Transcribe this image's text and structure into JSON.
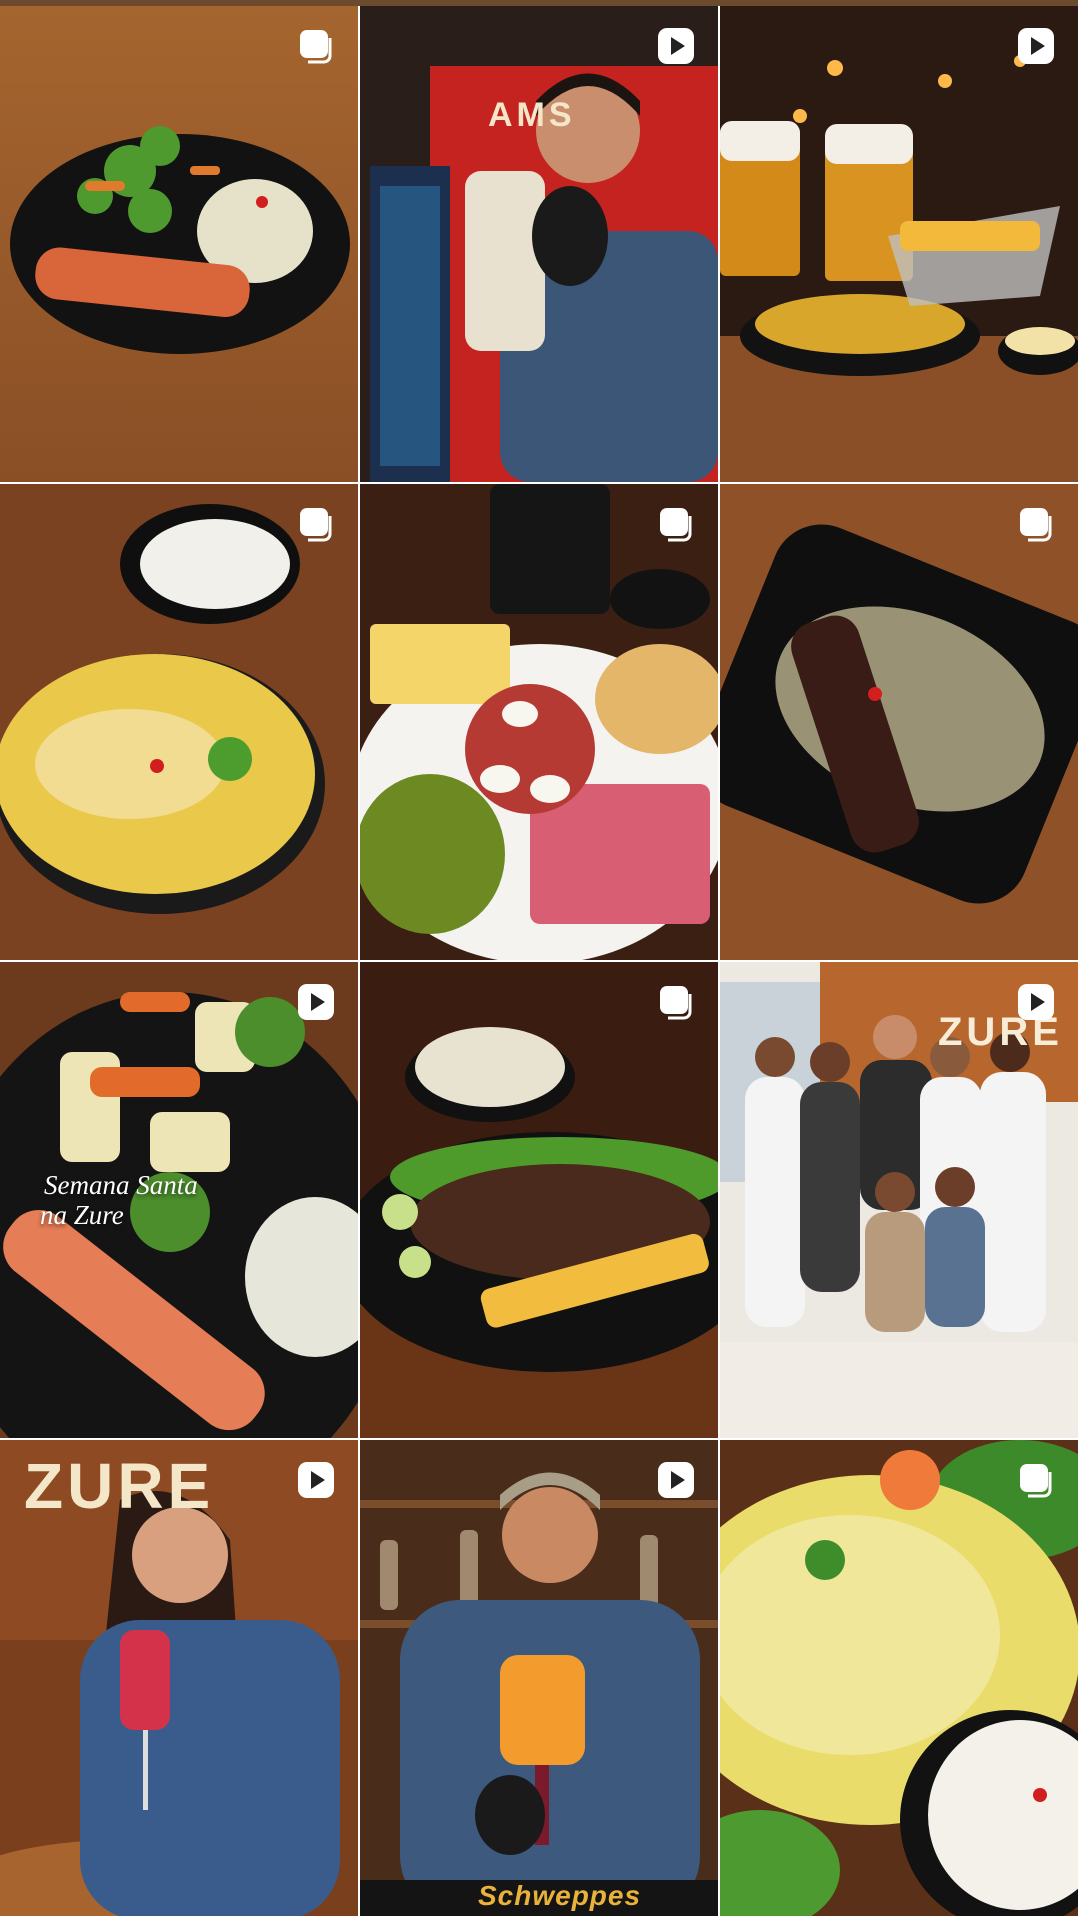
{
  "grid": {
    "posts": [
      {
        "type": "carousel",
        "badge_icon": "carousel-icon"
      },
      {
        "type": "reel",
        "badge_icon": "reel-icon",
        "sign_text": "AMS"
      },
      {
        "type": "reel",
        "badge_icon": "reel-icon"
      },
      {
        "type": "carousel",
        "badge_icon": "carousel-icon"
      },
      {
        "type": "carousel",
        "badge_icon": "carousel-icon"
      },
      {
        "type": "carousel",
        "badge_icon": "carousel-icon"
      },
      {
        "type": "reel",
        "badge_icon": "reel-icon",
        "overlay_line1": "Semana Santa",
        "overlay_line2": "na Zure"
      },
      {
        "type": "carousel",
        "badge_icon": "carousel-icon"
      },
      {
        "type": "reel",
        "badge_icon": "reel-icon",
        "sign_text": "ZURE"
      },
      {
        "type": "reel",
        "badge_icon": "reel-icon",
        "sign_text": "ZURE"
      },
      {
        "type": "reel",
        "badge_icon": "reel-icon",
        "mat_text": "Schweppes"
      },
      {
        "type": "carousel",
        "badge_icon": "carousel-icon"
      }
    ]
  },
  "colors": {
    "wood": "#8a4f26",
    "wood_dark": "#5a3016",
    "plate": "#151515",
    "badge": "#ffffff"
  }
}
